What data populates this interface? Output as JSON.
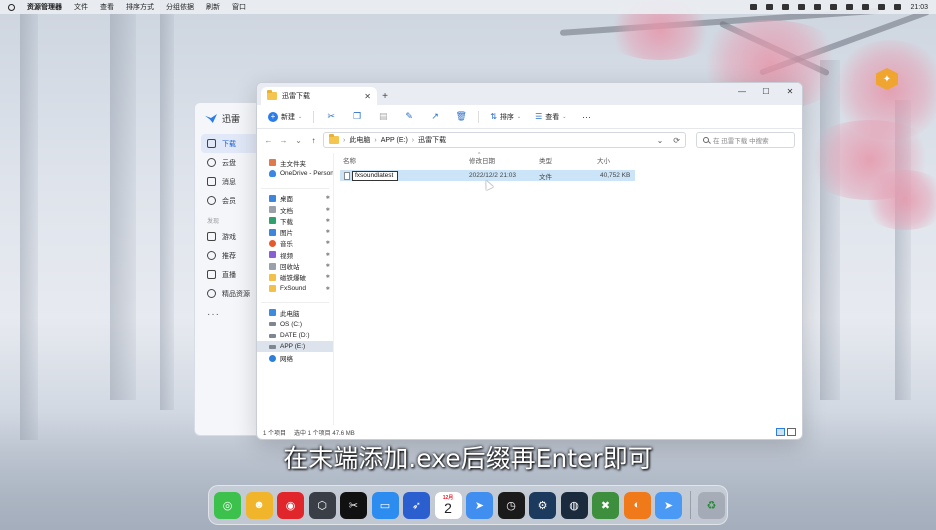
{
  "menubar": {
    "app_name": "资源管理器",
    "menus": [
      "文件",
      "查看",
      "排序方式",
      "分组依据",
      "刷新",
      "窗口"
    ],
    "clock": "21:03",
    "status_icons": [
      "bluetooth-icon",
      "wifi-icon",
      "battery-icon",
      "display-icon",
      "network-icon",
      "lock-icon",
      "flag-icon",
      "user-icon",
      "search-icon",
      "control-center-icon"
    ]
  },
  "xunlei": {
    "title": "迅雷",
    "nav": [
      {
        "label": "下载",
        "icon": "download-icon"
      },
      {
        "label": "云盘",
        "icon": "cloud-drive-icon"
      },
      {
        "label": "消息",
        "icon": "message-icon"
      },
      {
        "label": "会员",
        "icon": "vip-icon"
      }
    ],
    "section_label": "发现",
    "discover": [
      {
        "label": "游戏",
        "icon": "game-icon"
      },
      {
        "label": "推荐",
        "icon": "recommend-icon"
      },
      {
        "label": "直播",
        "icon": "live-icon"
      },
      {
        "label": "精品资源",
        "icon": "resource-icon"
      }
    ],
    "more": "···"
  },
  "explorer": {
    "tab_title": "迅雷下载",
    "toolbar": {
      "new_label": "新建",
      "sort_label": "排序",
      "view_label": "查看",
      "more_label": "···"
    },
    "breadcrumb": [
      "此电脑",
      "APP (E:)",
      "迅雷下载"
    ],
    "search_placeholder": "在 迅雷下载 中搜索",
    "nav": {
      "top": [
        {
          "label": "主文件夹",
          "icon": "home-icon",
          "cls": "home",
          "pinned": false
        },
        {
          "label": "OneDrive - Person",
          "icon": "onedrive-icon",
          "cls": "cloud",
          "pinned": false
        }
      ],
      "quick": [
        {
          "label": "桌面",
          "icon": "desktop-icon",
          "cls": "blue",
          "pinned": true
        },
        {
          "label": "文档",
          "icon": "documents-icon",
          "cls": "gray",
          "pinned": true
        },
        {
          "label": "下载",
          "icon": "downloads-icon",
          "cls": "green",
          "pinned": true
        },
        {
          "label": "图片",
          "icon": "pictures-icon",
          "cls": "blue",
          "pinned": true
        },
        {
          "label": "音乐",
          "icon": "music-icon",
          "cls": "orange",
          "pinned": true
        },
        {
          "label": "视频",
          "icon": "videos-icon",
          "cls": "purple",
          "pinned": true
        },
        {
          "label": "回收站",
          "icon": "recycle-bin-icon",
          "cls": "gray",
          "pinned": true
        },
        {
          "label": "磁铁爆破",
          "icon": "folder-icon",
          "cls": "yellow",
          "pinned": true
        },
        {
          "label": "FxSound",
          "icon": "folder-icon",
          "cls": "yellow",
          "pinned": true
        }
      ],
      "pc": [
        {
          "label": "此电脑",
          "icon": "this-pc-icon",
          "cls": "pc",
          "selected": false
        },
        {
          "label": "OS (C:)",
          "icon": "drive-icon",
          "cls": "drive",
          "selected": false
        },
        {
          "label": "DATE (D:)",
          "icon": "drive-icon",
          "cls": "drive",
          "selected": false
        },
        {
          "label": "APP (E:)",
          "icon": "drive-icon",
          "cls": "drive",
          "selected": true
        },
        {
          "label": "网络",
          "icon": "network-icon",
          "cls": "net",
          "selected": false
        }
      ]
    },
    "columns": {
      "name": "名称",
      "date": "修改日期",
      "type": "类型",
      "size": "大小"
    },
    "file": {
      "rename_value": "fxsoundlatest",
      "date": "2022/12/2 21:03",
      "type": "文件",
      "size": "40,752 KB"
    },
    "status": {
      "count": "1 个项目",
      "selected": "选中 1 个项目  47.6 MB"
    }
  },
  "subtitle": "在末端添加.exe后缀再Enter即可",
  "dock": {
    "calendar_month": "12月",
    "calendar_day": "2",
    "apps": [
      {
        "name": "wechat-icon",
        "color": "#3cc24c",
        "glyph": "◎"
      },
      {
        "name": "finder-icon",
        "color": "#f0b52a",
        "glyph": "☻"
      },
      {
        "name": "netease-music-icon",
        "color": "#e0262a",
        "glyph": "◉"
      },
      {
        "name": "app-icon",
        "color": "#3a3f47",
        "glyph": "⬡"
      },
      {
        "name": "capcut-icon",
        "color": "#111111",
        "glyph": "✂"
      },
      {
        "name": "desktop-icon",
        "color": "#2d8cf0",
        "glyph": "▭"
      },
      {
        "name": "rocket-icon",
        "color": "#2b5fcf",
        "glyph": "➶"
      },
      {
        "name": "calendar-icon",
        "color": "#ffffff",
        "glyph": ""
      },
      {
        "name": "xunlei-icon",
        "color": "#3f8ef0",
        "glyph": "➤"
      },
      {
        "name": "clock-icon",
        "color": "#1a1a1a",
        "glyph": "◷"
      },
      {
        "name": "steam-icon",
        "color": "#1c3a5e",
        "glyph": "⚙"
      },
      {
        "name": "app-icon",
        "color": "#1b2b3d",
        "glyph": "◍"
      },
      {
        "name": "xbox-icon",
        "color": "#3d8f3d",
        "glyph": "✖"
      },
      {
        "name": "app-icon",
        "color": "#f07a1a",
        "glyph": "◐"
      },
      {
        "name": "xunlei-icon",
        "color": "#4a9af5",
        "glyph": "➤"
      }
    ],
    "trash_icon": "recycle-bin-icon"
  }
}
